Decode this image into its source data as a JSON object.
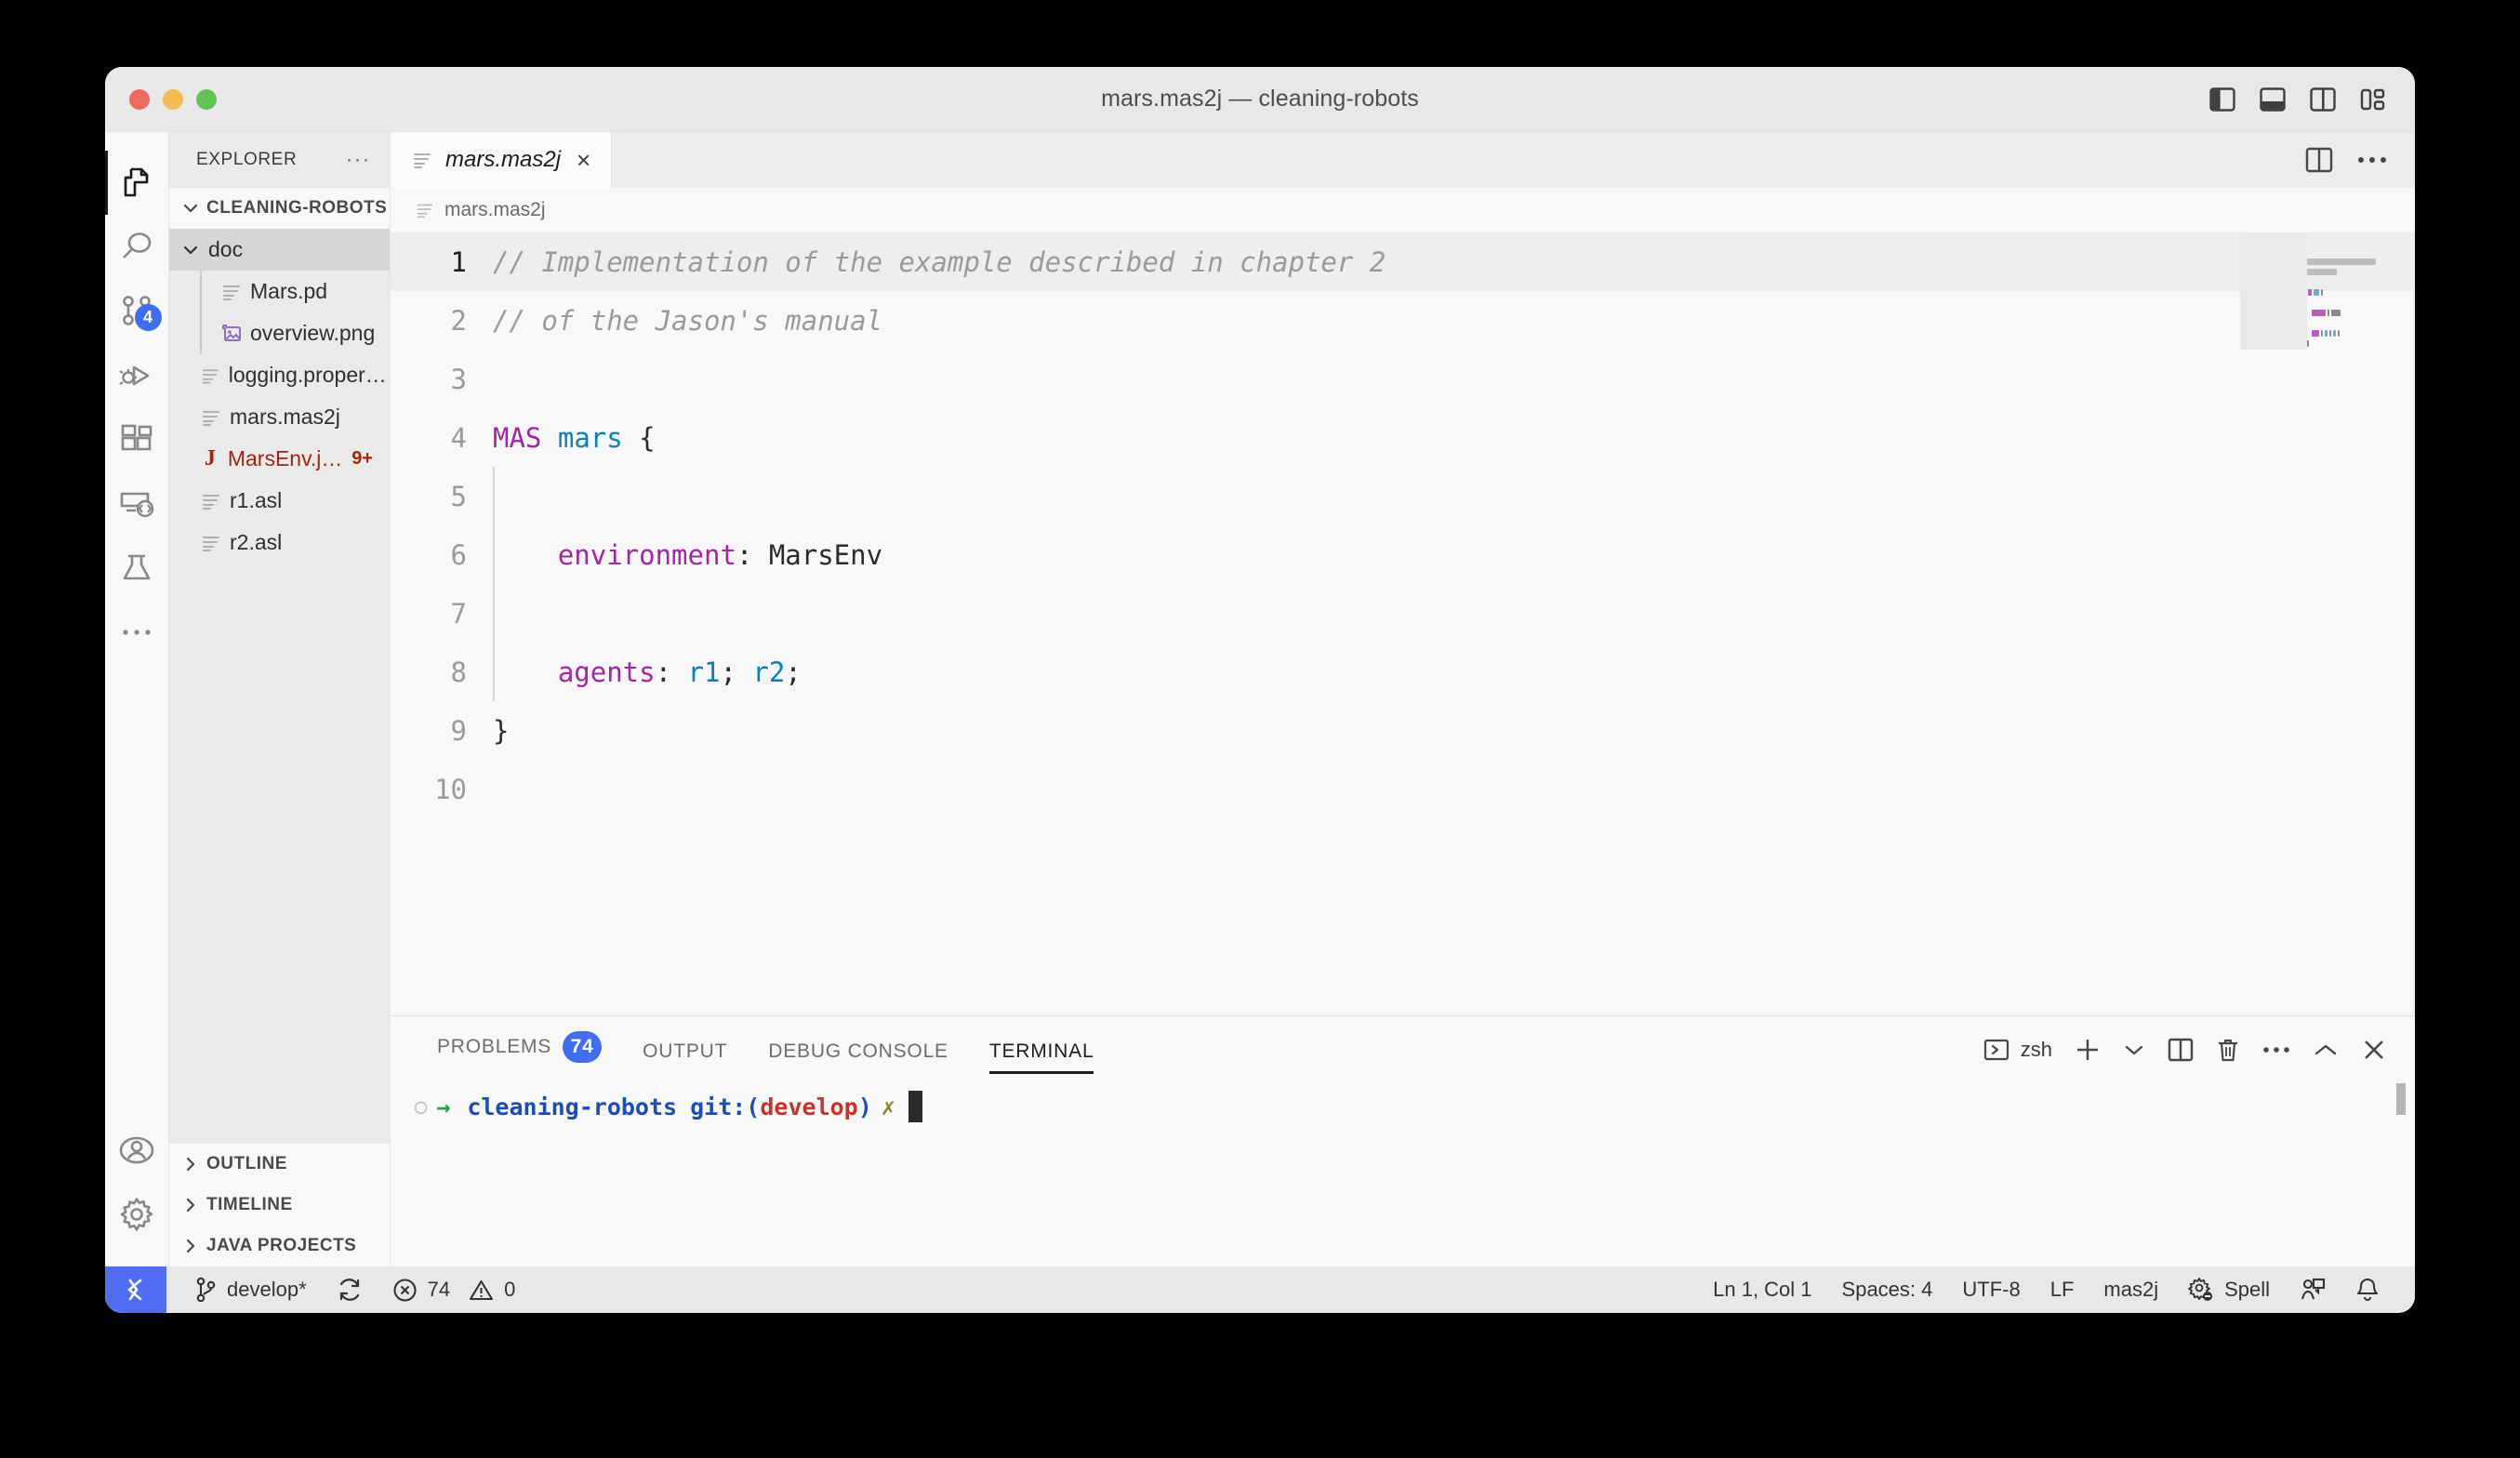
{
  "window": {
    "title": "mars.mas2j — cleaning-robots",
    "traffic_lights": [
      "close-red",
      "minimize-yellow",
      "maximize-green"
    ],
    "layout_icons": [
      "toggle-primary-sidebar",
      "toggle-panel",
      "toggle-secondary-sidebar",
      "customize-layout"
    ]
  },
  "activity_bar": {
    "items": [
      {
        "name": "explorer",
        "icon": "files-icon",
        "active": true,
        "badge": ""
      },
      {
        "name": "search",
        "icon": "search-icon",
        "active": false,
        "badge": ""
      },
      {
        "name": "source-control",
        "icon": "source-control-icon",
        "active": false,
        "badge": "4"
      },
      {
        "name": "run-and-debug",
        "icon": "debug-icon",
        "active": false,
        "badge": ""
      },
      {
        "name": "extensions",
        "icon": "extensions-icon",
        "active": false,
        "badge": ""
      },
      {
        "name": "remote-explorer",
        "icon": "remote-explorer-icon",
        "active": false,
        "badge": ""
      },
      {
        "name": "testing",
        "icon": "beaker-icon",
        "active": false,
        "badge": ""
      },
      {
        "name": "additional-views",
        "icon": "ellipsis-icon",
        "active": false,
        "badge": ""
      }
    ],
    "bottom_items": [
      {
        "name": "accounts",
        "icon": "account-icon"
      },
      {
        "name": "manage-settings",
        "icon": "gear-icon"
      }
    ]
  },
  "sidebar": {
    "header": {
      "title": "EXPLORER",
      "more_actions": "···"
    },
    "root_section": {
      "label": "CLEANING-ROBOTS",
      "expanded": true
    },
    "tree": [
      {
        "label": "doc",
        "icon": "folder-open-icon",
        "depth": 0,
        "type": "folder",
        "expanded": true,
        "selected": true,
        "badge": "",
        "error": false
      },
      {
        "label": "Mars.pd",
        "icon": "file-lines-icon",
        "depth": 1,
        "type": "file",
        "badge": "",
        "error": false,
        "guide": true
      },
      {
        "label": "overview.png",
        "icon": "image-icon",
        "depth": 1,
        "type": "file",
        "badge": "",
        "error": false,
        "guide": true
      },
      {
        "label": "logging.properties",
        "icon": "file-lines-icon",
        "depth": 0,
        "type": "file",
        "badge": "",
        "error": false
      },
      {
        "label": "mars.mas2j",
        "icon": "file-lines-icon",
        "depth": 0,
        "type": "file",
        "badge": "",
        "error": false
      },
      {
        "label": "MarsEnv.java",
        "icon": "java-icon",
        "depth": 0,
        "type": "file",
        "badge": "9+",
        "error": true
      },
      {
        "label": "r1.asl",
        "icon": "file-lines-icon",
        "depth": 0,
        "type": "file",
        "badge": "",
        "error": false
      },
      {
        "label": "r2.asl",
        "icon": "file-lines-icon",
        "depth": 0,
        "type": "file",
        "badge": "",
        "error": false
      }
    ],
    "collapsed_sections": [
      {
        "label": "OUTLINE",
        "expanded": false
      },
      {
        "label": "TIMELINE",
        "expanded": false
      },
      {
        "label": "JAVA PROJECTS",
        "expanded": false
      }
    ]
  },
  "editor": {
    "tabs": [
      {
        "label": "mars.mas2j",
        "icon": "file-lines-icon",
        "active": true,
        "italic": true,
        "close": "×"
      }
    ],
    "tab_actions": [
      "split-editor-icon",
      "more-actions-icon"
    ],
    "breadcrumb": {
      "icon": "file-lines-icon",
      "label": "mars.mas2j"
    },
    "cursor_line": 1,
    "lines": [
      {
        "n": "1",
        "current": true,
        "tokens": [
          {
            "t": "// Implementation of the example described in chapter 2",
            "c": "cmt"
          }
        ]
      },
      {
        "n": "2",
        "current": false,
        "tokens": [
          {
            "t": "// of the Jason's manual",
            "c": "cmt"
          }
        ]
      },
      {
        "n": "3",
        "current": false,
        "tokens": []
      },
      {
        "n": "4",
        "current": false,
        "tokens": [
          {
            "t": "MAS",
            "c": "kw"
          },
          {
            "t": " ",
            "c": "pun"
          },
          {
            "t": "mars",
            "c": "id"
          },
          {
            "t": " {",
            "c": "pun"
          }
        ]
      },
      {
        "n": "5",
        "current": false,
        "tokens": []
      },
      {
        "n": "6",
        "current": false,
        "tokens": [
          {
            "t": "    ",
            "c": "pun"
          },
          {
            "t": "environment",
            "c": "kw"
          },
          {
            "t": ": ",
            "c": "pun"
          },
          {
            "t": "MarsEnv",
            "c": "pun"
          }
        ]
      },
      {
        "n": "7",
        "current": false,
        "tokens": []
      },
      {
        "n": "8",
        "current": false,
        "tokens": [
          {
            "t": "    ",
            "c": "pun"
          },
          {
            "t": "agents",
            "c": "kw"
          },
          {
            "t": ": ",
            "c": "pun"
          },
          {
            "t": "r1",
            "c": "id"
          },
          {
            "t": "; ",
            "c": "pun"
          },
          {
            "t": "r2",
            "c": "id"
          },
          {
            "t": ";",
            "c": "pun"
          }
        ]
      },
      {
        "n": "9",
        "current": false,
        "tokens": [
          {
            "t": "}",
            "c": "pun"
          }
        ]
      },
      {
        "n": "10",
        "current": false,
        "tokens": []
      }
    ]
  },
  "panel": {
    "tabs": [
      {
        "label": "PROBLEMS",
        "badge": "74",
        "active": false
      },
      {
        "label": "OUTPUT",
        "badge": "",
        "active": false
      },
      {
        "label": "DEBUG CONSOLE",
        "badge": "",
        "active": false
      },
      {
        "label": "TERMINAL",
        "badge": "",
        "active": true
      }
    ],
    "shell_label": "zsh",
    "actions": [
      "new-terminal-icon",
      "terminal-dropdown-icon",
      "split-terminal-icon",
      "kill-terminal-icon",
      "more-actions-icon",
      "collapse-panel-icon",
      "close-panel-icon"
    ],
    "terminal": {
      "status_dot": "○",
      "arrow": "→",
      "path": "cleaning-robots",
      "git_label": "git:(",
      "branch": "develop",
      "git_close": ")",
      "dirty_mark": "✗",
      "cursor": ""
    }
  },
  "status_bar": {
    "remote_icon": "remote-window-icon",
    "left": [
      {
        "name": "branch",
        "icon": "git-branch-icon",
        "label": "develop*"
      },
      {
        "name": "sync-changes",
        "icon": "sync-icon",
        "label": ""
      },
      {
        "name": "problems",
        "icon": "error-icon",
        "label": "74",
        "icon2": "warning-icon",
        "label2": "0"
      }
    ],
    "right": [
      {
        "name": "cursor-position",
        "label": "Ln 1, Col 1"
      },
      {
        "name": "indentation",
        "label": "Spaces: 4"
      },
      {
        "name": "encoding",
        "label": "UTF-8"
      },
      {
        "name": "eol",
        "label": "LF"
      },
      {
        "name": "language-mode",
        "label": "mas2j"
      },
      {
        "name": "spell-checker",
        "icon": "gear-spell-icon",
        "label": "Spell"
      },
      {
        "name": "live-share",
        "icon": "live-share-icon",
        "label": ""
      },
      {
        "name": "notifications",
        "icon": "bell-icon",
        "label": ""
      }
    ]
  },
  "colors": {
    "accent_blue": "#3f6ef2",
    "remote_blue": "#4f6ef4",
    "error_red": "#a1260d",
    "keyword_purple": "#a426a4",
    "identifier_blue": "#0b7ec4",
    "comment_gray": "#9a9a9a",
    "terminal_green": "#25a244",
    "terminal_branch_red": "#c6352b",
    "terminal_path_blue": "#1c4fb5"
  }
}
